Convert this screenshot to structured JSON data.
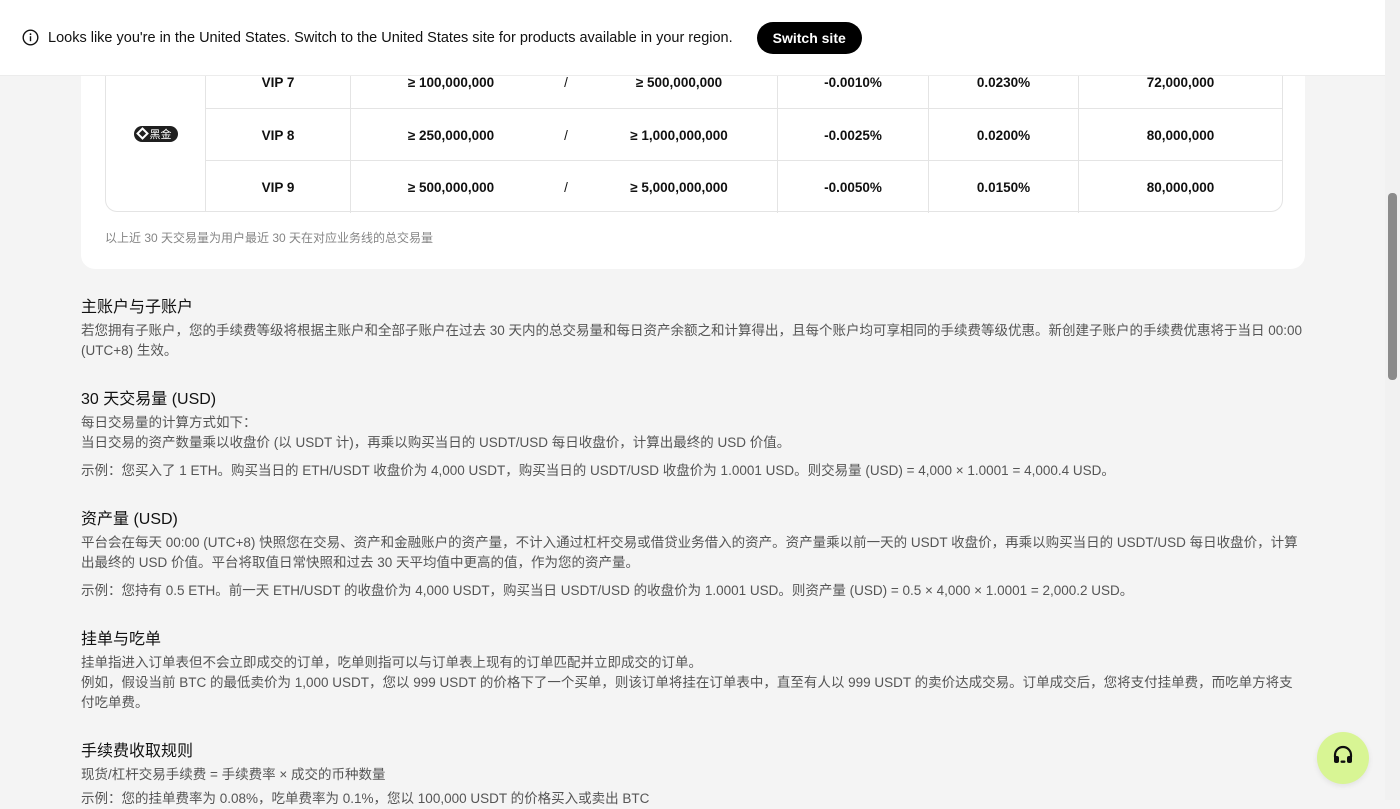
{
  "banner": {
    "message": "Looks like you're in the United States. Switch to the United States site for products available in your region.",
    "button_label": "Switch site"
  },
  "fee_table": {
    "tier_badge": "黑金",
    "rows": [
      {
        "level": "VIP 7",
        "volume": "≥ 100,000,000",
        "separator": "/",
        "assets": "≥ 500,000,000",
        "maker": "-0.0010%",
        "taker": "0.0230%",
        "limit": "72,000,000"
      },
      {
        "level": "VIP 8",
        "volume": "≥ 250,000,000",
        "separator": "/",
        "assets": "≥ 1,000,000,000",
        "maker": "-0.0025%",
        "taker": "0.0200%",
        "limit": "80,000,000"
      },
      {
        "level": "VIP 9",
        "volume": "≥ 500,000,000",
        "separator": "/",
        "assets": "≥ 5,000,000,000",
        "maker": "-0.0050%",
        "taker": "0.0150%",
        "limit": "80,000,000"
      }
    ],
    "note": "以上近 30 天交易量为用户最近 30 天在对应业务线的总交易量"
  },
  "sections": {
    "subaccounts": {
      "title": "主账户与子账户",
      "body": "若您拥有子账户，您的手续费等级将根据主账户和全部子账户在过去 30 天内的总交易量和每日资产余额之和计算得出，且每个账户均可享相同的手续费等级优惠。新创建子账户的手续费优惠将于当日 00:00 (UTC+8) 生效。"
    },
    "volume": {
      "title": "30 天交易量 (USD)",
      "line1": "每日交易量的计算方式如下：",
      "line2": "当日交易的资产数量乘以收盘价 (以 USDT 计)，再乘以购买当日的 USDT/USD 每日收盘价，计算出最终的 USD 价值。",
      "example": "示例：您买入了 1 ETH。购买当日的 ETH/USDT 收盘价为 4,000 USDT，购买当日的 USDT/USD 收盘价为 1.0001 USD。则交易量 (USD) = 4,000 × 1.0001 = 4,000.4 USD。"
    },
    "assets": {
      "title": "资产量 (USD)",
      "body": "平台会在每天 00:00 (UTC+8) 快照您在交易、资产和金融账户的资产量，不计入通过杠杆交易或借贷业务借入的资产。资产量乘以前一天的 USDT 收盘价，再乘以购买当日的 USDT/USD 每日收盘价，计算出最终的 USD 价值。平台将取值日常快照和过去 30 天平均值中更高的值，作为您的资产量。",
      "example": "示例：您持有 0.5 ETH。前一天 ETH/USDT 的收盘价为 4,000 USDT，购买当日 USDT/USD 的收盘价为 1.0001 USD。则资产量 (USD) = 0.5 × 4,000 × 1.0001 = 2,000.2 USD。"
    },
    "maker_taker": {
      "title": "挂单与吃单",
      "line1": "挂单指进入订单表但不会立即成交的订单，吃单则指可以与订单表上现有的订单匹配并立即成交的订单。",
      "line2": "例如，假设当前 BTC 的最低卖价为 1,000 USDT，您以 999 USDT 的价格下了一个买单，则该订单将挂在订单表中，直至有人以 999 USDT 的卖价达成交易。订单成交后，您将支付挂单费，而吃单方将支付吃单费。"
    },
    "fee_rules": {
      "title": "手续费收取规则",
      "line1": "现货/杠杆交易手续费 = 手续费率 × 成交的币种数量",
      "line2": "示例：您的挂单费率为 0.08%，吃单费率为 0.1%，您以 100,000 USDT 的价格买入或卖出 BTC"
    }
  },
  "colors": {
    "page_bg": "#f4f4f4",
    "accent_support": "#d8f594",
    "button_bg": "#000000"
  },
  "icons": {
    "banner": "info-icon",
    "support": "headset-icon"
  }
}
